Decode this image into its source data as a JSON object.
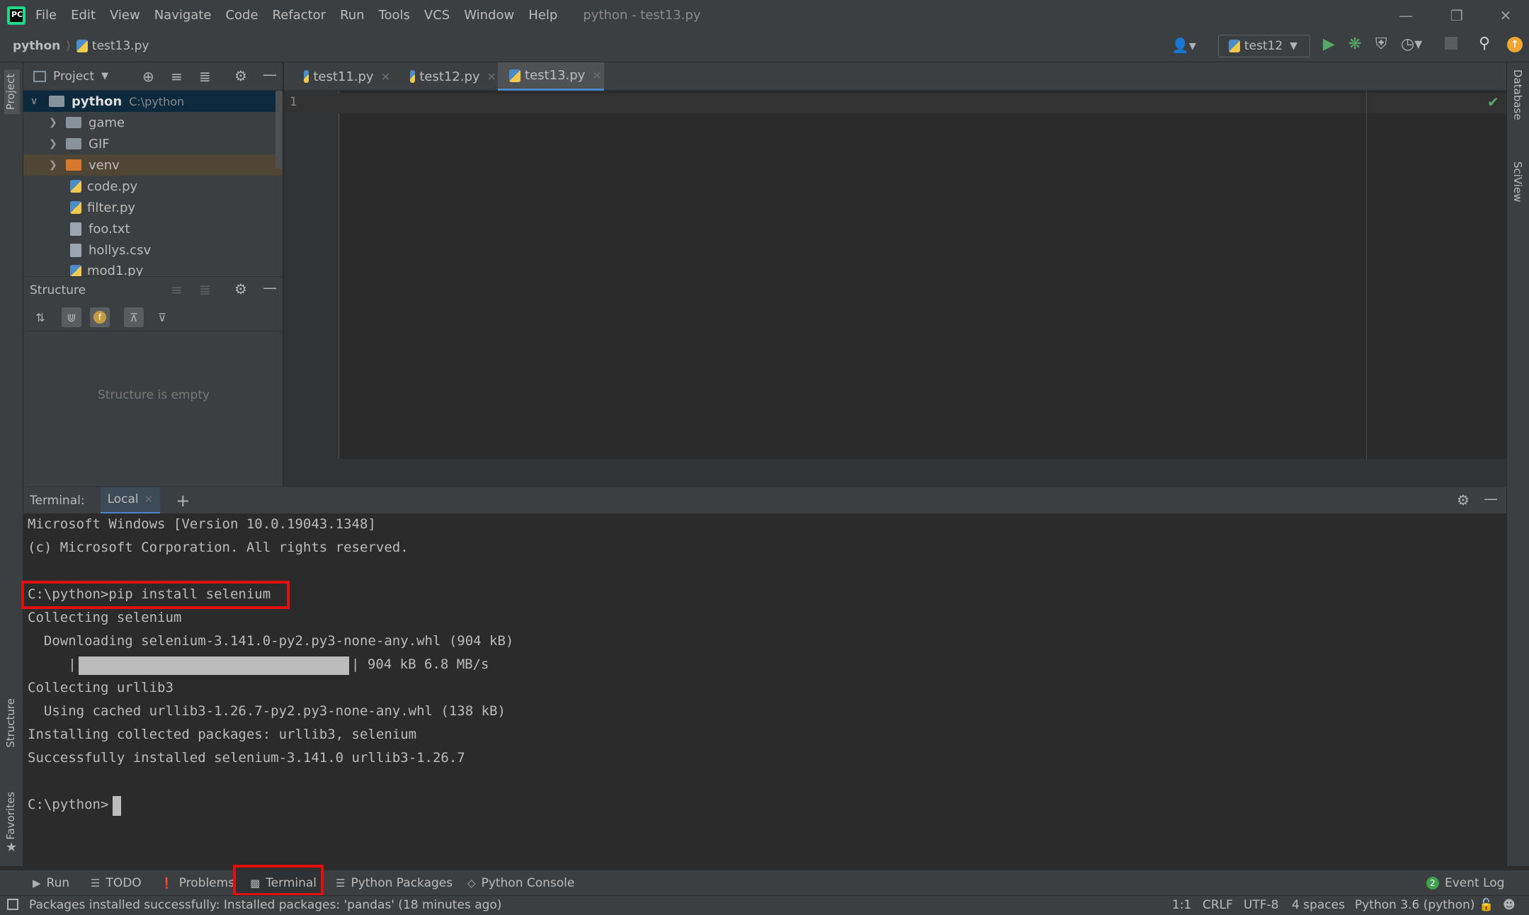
{
  "app": {
    "window_title": "python - test13.py",
    "menu": [
      "File",
      "Edit",
      "View",
      "Navigate",
      "Code",
      "Refactor",
      "Run",
      "Tools",
      "VCS",
      "Window",
      "Help"
    ]
  },
  "navbar": {
    "root": "python",
    "file": "test13.py",
    "run_config": "test12"
  },
  "project_panel": {
    "title": "Project",
    "root_label": "python",
    "root_path": "C:\\python",
    "items": [
      {
        "label": "game",
        "kind": "folder"
      },
      {
        "label": "GIF",
        "kind": "folder"
      },
      {
        "label": "venv",
        "kind": "folder-excluded"
      },
      {
        "label": "code.py",
        "kind": "py"
      },
      {
        "label": "filter.py",
        "kind": "py"
      },
      {
        "label": "foo.txt",
        "kind": "txt"
      },
      {
        "label": "hollys.csv",
        "kind": "csv"
      },
      {
        "label": "mod1.py",
        "kind": "py"
      }
    ]
  },
  "structure_panel": {
    "title": "Structure",
    "empty_text": "Structure is empty"
  },
  "editor": {
    "tabs": [
      {
        "label": "test11.py",
        "active": false
      },
      {
        "label": "test12.py",
        "active": false
      },
      {
        "label": "test13.py",
        "active": true
      }
    ],
    "line_numbers": [
      "1"
    ]
  },
  "terminal": {
    "title": "Terminal:",
    "tab": "Local",
    "lines": [
      "Microsoft Windows [Version 10.0.19043.1348]",
      "(c) Microsoft Corporation. All rights reserved.",
      "",
      "C:\\python>pip install selenium",
      "Collecting selenium",
      "  Downloading selenium-3.141.0-py2.py3-none-any.whl (904 kB)",
      "     |",
      "Collecting urllib3",
      "  Using cached urllib3-1.26.7-py2.py3-none-any.whl (138 kB)",
      "Installing collected packages: urllib3, selenium",
      "Successfully installed selenium-3.141.0 urllib3-1.26.7",
      "",
      "C:\\python>"
    ],
    "progress_suffix": "| 904 kB 6.8 MB/s",
    "progress_fraction": 1.0
  },
  "left_strip": {
    "project": "Project",
    "structure": "Structure",
    "favorites": "Favorites"
  },
  "right_strip": {
    "database": "Database",
    "sciview": "SciView"
  },
  "bottom_tabs": [
    "Run",
    "TODO",
    "Problems",
    "Terminal",
    "Python Packages",
    "Python Console"
  ],
  "event_log": {
    "label": "Event Log",
    "count": "2"
  },
  "status": {
    "message": "Packages installed successfully: Installed packages: 'pandas' (18 minutes ago)",
    "position": "1:1",
    "line_sep": "CRLF",
    "encoding": "UTF-8",
    "indent": "4 spaces",
    "interpreter": "Python 3.6 (python)"
  },
  "colors": {
    "highlight_box": "#e01010",
    "accent": "#4a88c7",
    "run_green": "#59a869"
  }
}
